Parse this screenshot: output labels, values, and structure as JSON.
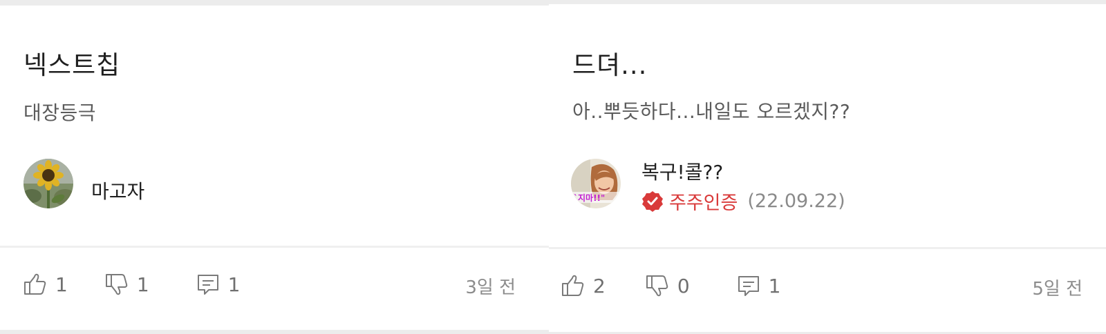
{
  "posts": [
    {
      "title": "넥스트칩",
      "body": "대장등극",
      "author": "마고자",
      "avatar_icon": "sunflower-avatar-icon",
      "likes": "1",
      "dislikes": "1",
      "comments": "1",
      "time": "3일 전"
    },
    {
      "title": "드뎌...",
      "body": "아..뿌듯하다...내일도 오르겠지??",
      "author": "복구!콜??",
      "avatar_icon": "person-avatar-icon",
      "verify_label": "주주인증",
      "verify_date": "(22.09.22)",
      "avatar_caption": "`지마!!\"",
      "likes": "2",
      "dislikes": "0",
      "comments": "1",
      "time": "5일 전"
    }
  ],
  "icons": {
    "like": "thumbs-up-icon",
    "dislike": "thumbs-down-icon",
    "comment": "comment-icon",
    "verified": "verified-badge-icon"
  },
  "colors": {
    "verified_red": "#d93a3a",
    "text_dark": "#1f1f1f",
    "text_muted": "#707070"
  }
}
